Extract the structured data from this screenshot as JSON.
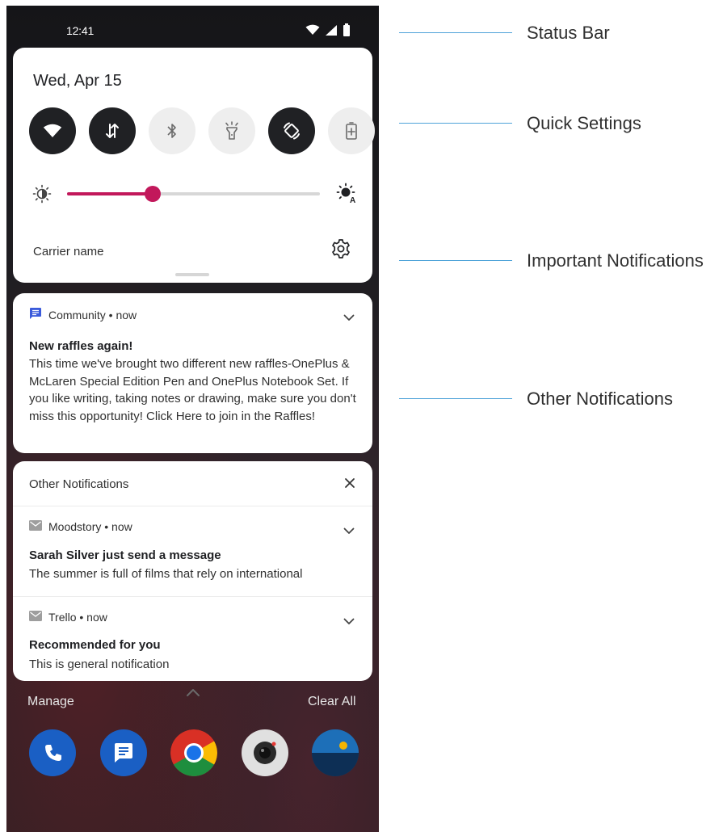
{
  "status_bar": {
    "time": "12:41",
    "icons": [
      "wifi-icon",
      "cell-signal-icon",
      "battery-icon"
    ]
  },
  "quick_settings": {
    "date": "Wed, Apr 15",
    "tiles": [
      {
        "icon": "wifi-icon",
        "state": "on"
      },
      {
        "icon": "mobile-data-icon",
        "state": "on"
      },
      {
        "icon": "bluetooth-icon",
        "state": "off"
      },
      {
        "icon": "flashlight-icon",
        "state": "off"
      },
      {
        "icon": "auto-rotate-icon",
        "state": "on"
      },
      {
        "icon": "battery-saver-icon",
        "state": "off"
      }
    ],
    "brightness_level": 0.34,
    "accent_color": "#c2185b",
    "carrier_name": "Carrier name"
  },
  "important_notification": {
    "app": "Community",
    "time": "now",
    "header": "Community • now",
    "title": "New raffles again!",
    "body": "This time we've brought two different new raffles-OnePlus & McLaren Special Edition Pen and OnePlus Notebook Set. If you like writing, taking notes or drawing, make sure you don't miss this opportunity! Click Here to join in the Raffles!"
  },
  "other_notifications": {
    "header": "Other Notifications",
    "items": [
      {
        "header": "Moodstory • now",
        "title": "Sarah Silver just send a message",
        "body": "The summer is full of films that rely on international"
      },
      {
        "header": "Trello • now",
        "title": "Recommended for you",
        "body": "This is general notification"
      }
    ]
  },
  "footer": {
    "manage": "Manage",
    "clear_all": "Clear All"
  },
  "dock_apps": [
    "phone-icon",
    "messages-icon",
    "chrome-icon",
    "camera-icon",
    "gallery-icon"
  ],
  "annotations": {
    "status_bar": "Status Bar",
    "quick_settings": "Quick Settings",
    "important_notifications": "Important Notifications",
    "other_notifications": "Other Notifications"
  }
}
